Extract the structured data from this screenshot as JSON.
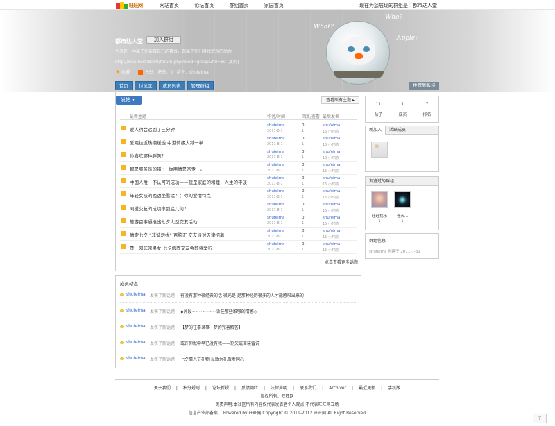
{
  "topbar": {
    "logo_text": "旺旺网",
    "nav": [
      "网站首页",
      "论坛首页",
      "群组首页",
      "家园首页"
    ],
    "right_text": "现在为您展现的群组是：都市达人堂"
  },
  "banner": {
    "group_name": "都市达人堂",
    "join_label": "加入群组",
    "description": "生活是一种属于你要做自己的舞台，做属于你们寻找梦想的动力",
    "url": "http://localhost:8080/forum.php?mod=group&fid=50 [复制]",
    "star_label": "收藏",
    "rss_label": "RSS",
    "points_label": "积分：0",
    "owner_label": "群主：shufeima",
    "bowl_words": [
      "What?",
      "Who?",
      "Apple?"
    ],
    "tabs": [
      "首页",
      "讨论区",
      "成员列表",
      "管理群组"
    ],
    "recommend_label": "推荐到板块"
  },
  "main": {
    "post_label": "发帖",
    "view_all_label": "查看所有主题",
    "headers": {
      "title": "最新主题",
      "author": "作者/时间",
      "reply": "回复/查看",
      "last": "最后发表"
    },
    "topics": [
      {
        "title": "爱人约会迟到了三分钟!",
        "author": "shufeima",
        "date": "2011-8-1",
        "replies": "0",
        "views": "1",
        "last_user": "shufeima",
        "last_time": "15 小时前"
      },
      {
        "title": "爱距拉近热潮缓透 中港情缘大减一半",
        "author": "shufeima",
        "date": "2011-8-1",
        "replies": "0",
        "views": "1",
        "last_user": "shufeima",
        "last_time": "15 小时前"
      },
      {
        "title": "你喜欢哪种胖美？",
        "author": "shufeima",
        "date": "2011-8-1",
        "replies": "0",
        "views": "1",
        "last_user": "shufeima",
        "last_time": "15 小时前"
      },
      {
        "title": "都是服务员的错 ： 你用情是否专一。",
        "author": "shufeima",
        "date": "2011-8-1",
        "replies": "0",
        "views": "1",
        "last_user": "shufeima",
        "last_time": "15 小时前"
      },
      {
        "title": "中国人唯一不认可的成功——就是家庭的和睦，人生的平淡",
        "author": "shufeima",
        "date": "2011-8-1",
        "replies": "0",
        "views": "1",
        "last_user": "shufeima",
        "last_time": "15 小时前"
      },
      {
        "title": "年轻女孩的晚边坐看诸？：你的爱情特点！",
        "author": "shufeima",
        "date": "2011-8-1",
        "replies": "0",
        "views": "1",
        "last_user": "shufeima",
        "last_time": "15 小时前"
      },
      {
        "title": "网投交友的成功率到底几何？",
        "author": "shufeima",
        "date": "2011-8-1",
        "replies": "0",
        "views": "1",
        "last_user": "shufeima",
        "last_time": "15 小时前"
      },
      {
        "title": "旅游百事通推出七夕大型交友活动",
        "author": "shufeima",
        "date": "2011-8-1",
        "replies": "0",
        "views": "1",
        "last_user": "shufeima",
        "last_time": "15 小时前"
      },
      {
        "title": "情定七夕 “非诚勿扰” 百脑汇 交友派对天津招募",
        "author": "shufeima",
        "date": "2011-8-1",
        "replies": "0",
        "views": "1",
        "last_user": "shufeima",
        "last_time": "15 小时前"
      },
      {
        "title": "贵一网非常男女 七夕假面交友会即将举行",
        "author": "shufeima",
        "date": "2011-8-1",
        "replies": "0",
        "views": "1",
        "last_user": "shufeima",
        "last_time": "15 小时前"
      }
    ],
    "more_label": "点击查看更多话题"
  },
  "activity": {
    "title": "成员动态",
    "items": [
      {
        "user": "shufeima",
        "verb": "发表了新话题",
        "content": "有没有那种很经典的话 很光是 是那种经历很多的人才能感叹出来的"
      },
      {
        "user": "shufeima",
        "verb": "发表了新话题",
        "content": "◆片段~~~~~~~诉任那些难够的情感◇"
      },
      {
        "user": "shufeima",
        "verb": "发表了新话题",
        "content": "【梦的往事录事 · 梦的完善解答】"
      },
      {
        "user": "shufeima",
        "verb": "发表了新话题",
        "content": "或许你默中早已没有我——割欠或苗装雷说"
      },
      {
        "user": "shufeima",
        "verb": "发表了新话题",
        "content": "七夕情人节礼物 以致为礼敬发同心"
      }
    ]
  },
  "sidebar": {
    "stats": [
      {
        "value": "11",
        "label": "贴子"
      },
      {
        "value": "1",
        "label": "成员"
      },
      {
        "value": "7",
        "label": "排名"
      }
    ],
    "member_tabs": [
      "新加入",
      "活跃成员"
    ],
    "visited_title": "浏览过的群组",
    "visited": [
      {
        "name": "旺旺找乐",
        "count": "1"
      },
      {
        "name": "苍天...",
        "count": "1"
      }
    ],
    "info_title": "群组信息",
    "info_text": "shufeima 创建于 2011-7-31"
  },
  "footer": {
    "links": [
      "关于我们",
      "积分规则",
      "论坛新规",
      "反馈倾吐",
      "法律声明",
      "联系我们",
      "Archiver",
      "最近更新",
      "手机版"
    ],
    "copyright_owner": "版权所有：旺旺网",
    "disclaimer": "免责声明:本社区所有内容仅代表发表者个人观点,不代表旺旺网立场",
    "powered": "信息产业部备案：  Powered by 旺旺网 Copyright © 2011-2012 旺旺网 All Right Reserved"
  },
  "colors": {
    "accent": "#3e78c0",
    "tab": "#3c7db7",
    "folder": "#f5b623",
    "link": "#3366cc"
  }
}
